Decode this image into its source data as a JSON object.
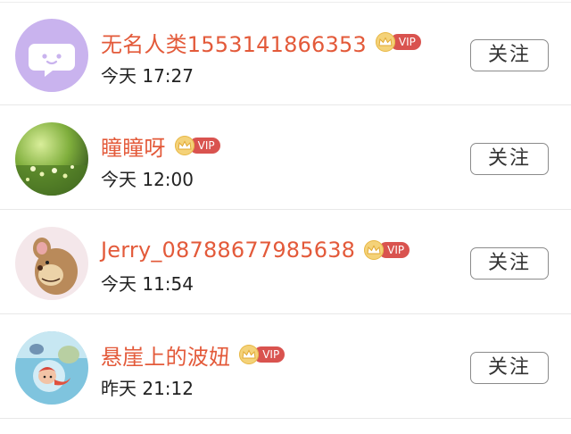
{
  "items": [
    {
      "name": "无名人类1553141866353",
      "vip_label": "VIP",
      "time": "今天 17:27",
      "follow_label": "关注",
      "avatar": "chat-bubble-avatar"
    },
    {
      "name": "瞳瞳呀",
      "vip_label": "VIP",
      "time": "今天 12:00",
      "follow_label": "关注",
      "avatar": "green-nature-avatar"
    },
    {
      "name": "Jerry_08788677985638",
      "vip_label": "VIP",
      "time": "今天 11:54",
      "follow_label": "关注",
      "avatar": "cartoon-mouse-avatar"
    },
    {
      "name": "悬崖上的波妞",
      "vip_label": "VIP",
      "time": "昨天 21:12",
      "follow_label": "关注",
      "avatar": "ponyo-avatar"
    }
  ],
  "colors": {
    "name": "#e35a3a",
    "vip_tag": "#d9534f",
    "crown": "#f4d279",
    "follow_border": "#8b8b8b"
  }
}
